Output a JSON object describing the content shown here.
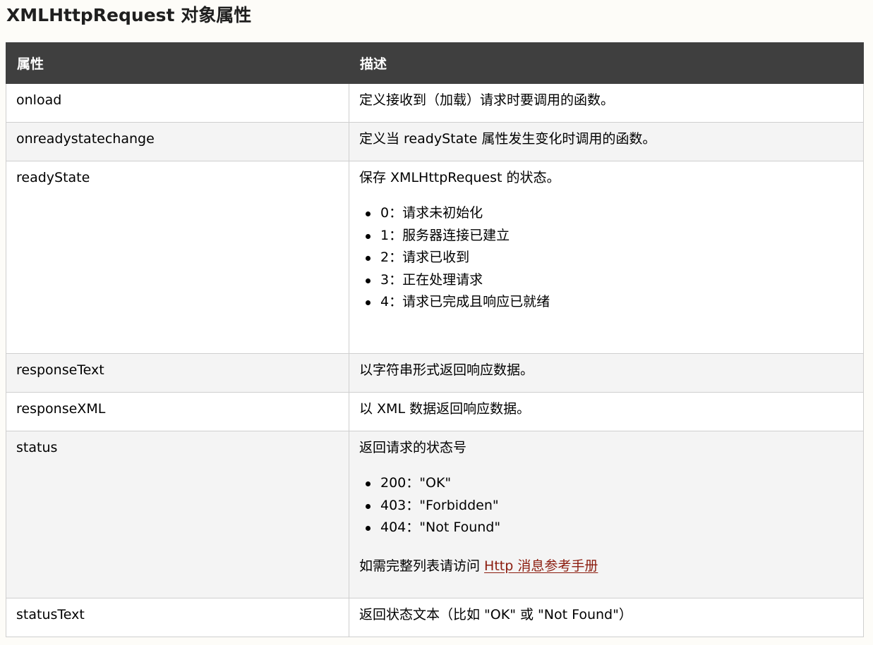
{
  "page_title": "XMLHttpRequest 对象属性",
  "table": {
    "headers": [
      "属性",
      "描述"
    ],
    "rows": [
      {
        "property": "onload",
        "description": "定义接收到（加载）请求时要调用的函数。"
      },
      {
        "property": "onreadystatechange",
        "description": "定义当 readyState 属性发生变化时调用的函数。"
      },
      {
        "property": "readyState",
        "description": "保存 XMLHttpRequest 的状态。",
        "list": [
          "0：请求未初始化",
          "1：服务器连接已建立",
          "2：请求已收到",
          "3：正在处理请求",
          "4：请求已完成且响应已就绪"
        ]
      },
      {
        "property": "responseText",
        "description": "以字符串形式返回响应数据。"
      },
      {
        "property": "responseXML",
        "description": "以 XML 数据返回响应数据。"
      },
      {
        "property": "status",
        "description": "返回请求的状态号",
        "list": [
          "200：\"OK\"",
          "403：\"Forbidden\"",
          "404：\"Not Found\""
        ],
        "footer_text": "如需完整列表请访问 ",
        "footer_link": "Http 消息参考手册"
      },
      {
        "property": "statusText",
        "description": "返回状态文本（比如 \"OK\" 或 \"Not Found\"）"
      }
    ]
  },
  "colors": {
    "header_bg": "#3f3f3f",
    "link": "#8b1c0e",
    "row_alt_bg": "#f4f4f4"
  }
}
